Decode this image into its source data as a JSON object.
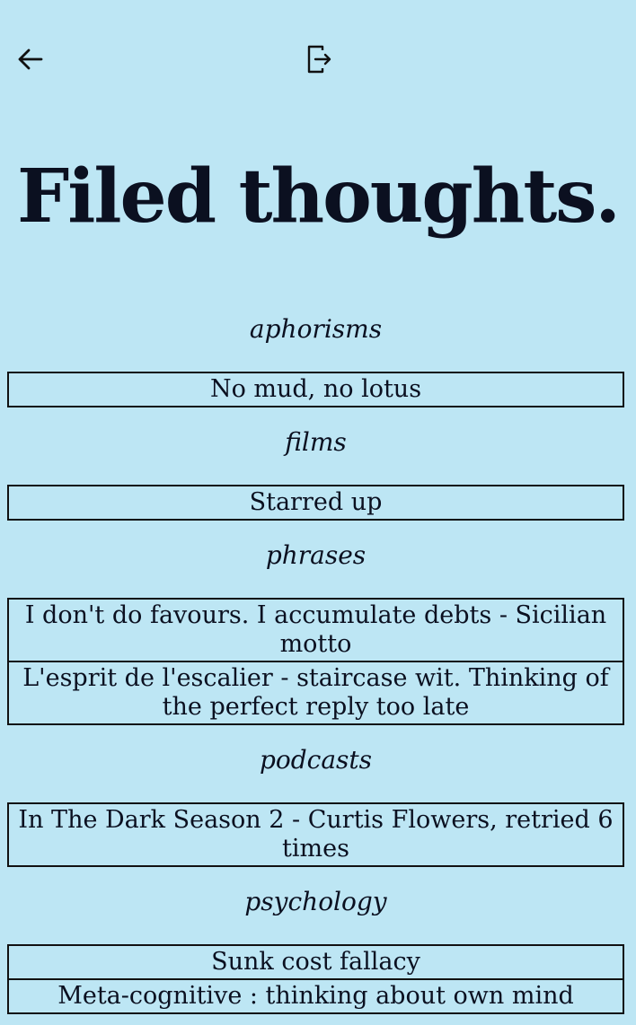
{
  "header": {
    "back_icon": "arrow-left-icon",
    "logout_icon": "logout-icon"
  },
  "page": {
    "title": "Filed thoughts."
  },
  "sections": [
    {
      "category": "aphorisms",
      "items": [
        "No mud, no lotus"
      ]
    },
    {
      "category": "films",
      "items": [
        "Starred up"
      ]
    },
    {
      "category": "phrases",
      "items": [
        "I don't do favours. I accumulate debts - Sicilian motto",
        "L'esprit de l'escalier - staircase wit. Thinking of the perfect reply too late"
      ]
    },
    {
      "category": "podcasts",
      "items": [
        "In The Dark Season 2 - Curtis Flowers, retried 6 times"
      ]
    },
    {
      "category": "psychology",
      "items": [
        "Sunk cost fallacy",
        "Meta-cognitive : thinking about own mind"
      ]
    }
  ],
  "colors": {
    "background": "#bde6f4",
    "text": "#0b1020",
    "border": "#111111"
  }
}
